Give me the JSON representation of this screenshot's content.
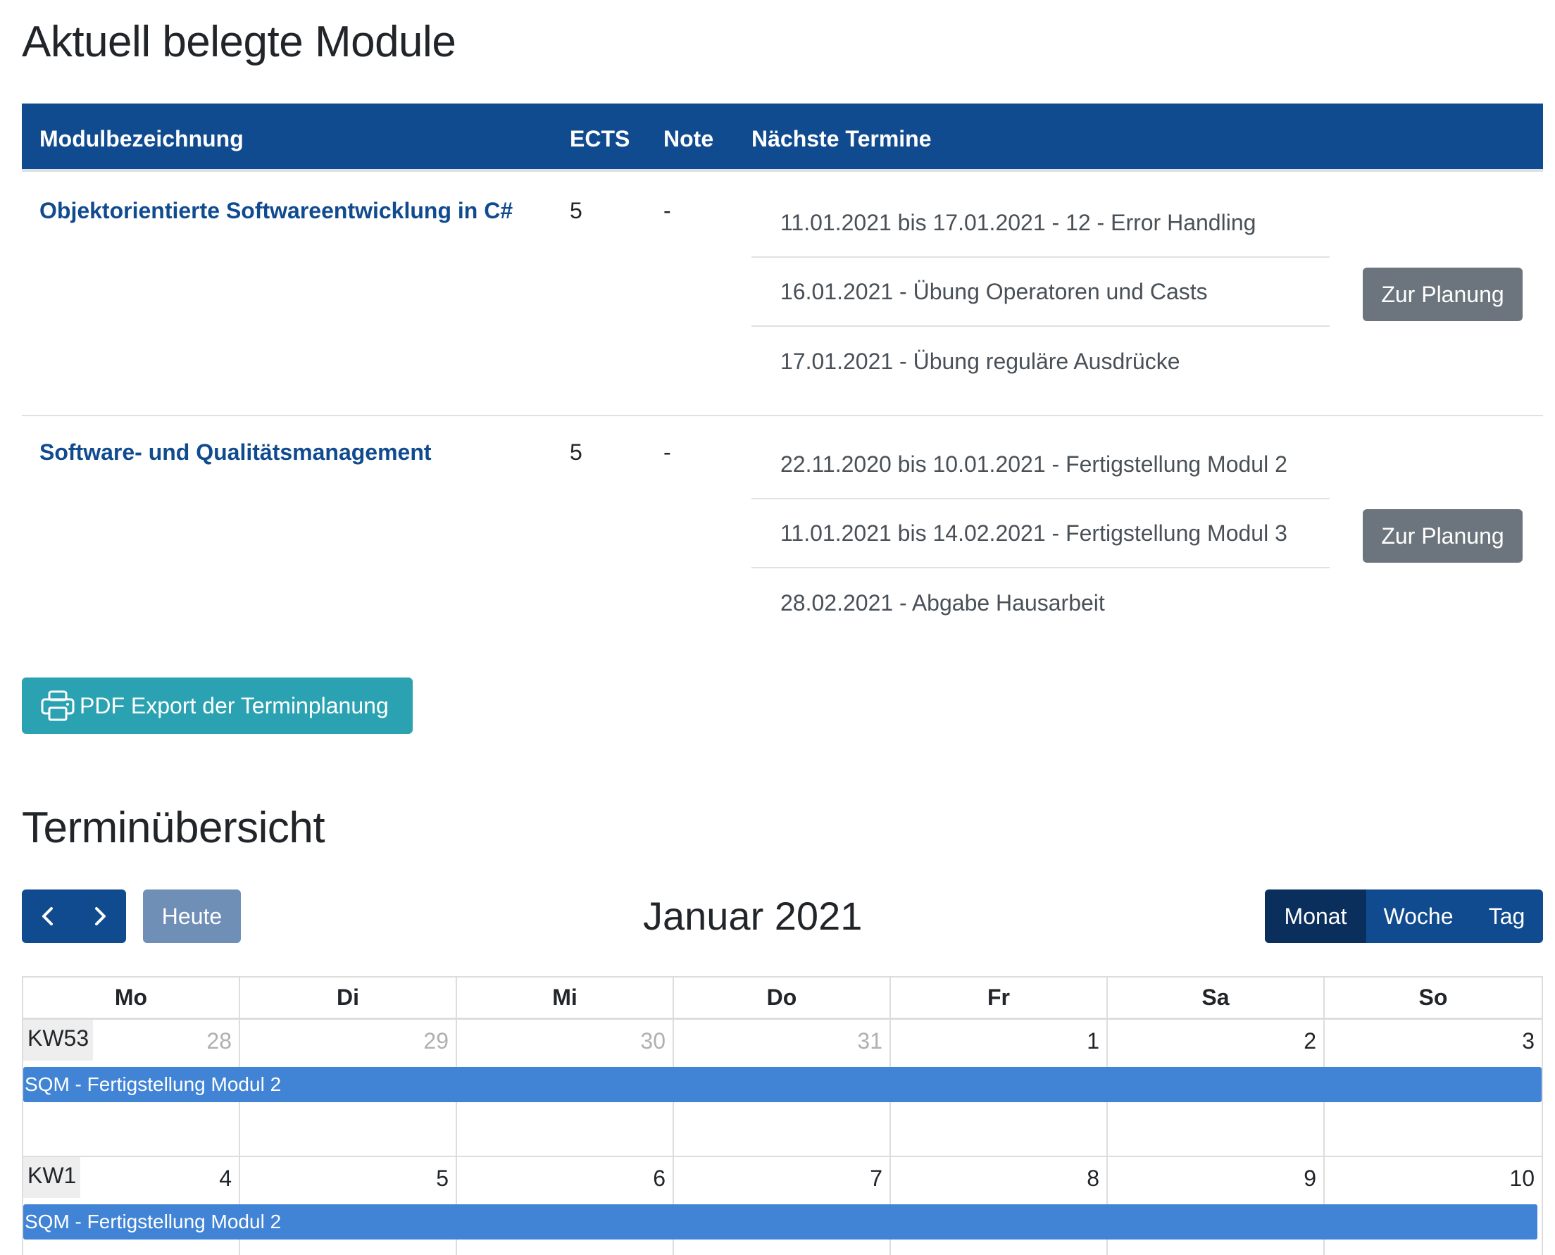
{
  "modules_section": {
    "title": "Aktuell belegte Module",
    "columns": [
      "Modulbezeichnung",
      "ECTS",
      "Note",
      "Nächste Termine"
    ],
    "rows": [
      {
        "name": "Objektorientierte Softwareentwicklung in C#",
        "ects": "5",
        "note": "-",
        "terms": [
          "11.01.2021 bis 17.01.2021 - 12 - Error Handling",
          "16.01.2021 - Übung Operatoren und Casts",
          "17.01.2021 - Übung reguläre Ausdrücke"
        ],
        "button": "Zur Planung"
      },
      {
        "name": "Software- und Qualitätsmanagement",
        "ects": "5",
        "note": "-",
        "terms": [
          "22.11.2020 bis 10.01.2021 - Fertigstellung Modul 2",
          "11.01.2021 bis 14.02.2021 - Fertigstellung Modul 3",
          "28.02.2021 - Abgabe Hausarbeit"
        ],
        "button": "Zur Planung"
      }
    ],
    "pdf_button": "PDF Export der Terminplanung"
  },
  "calendar_section": {
    "title": "Terminübersicht",
    "toolbar": {
      "prev_icon": "chevron-left-icon",
      "next_icon": "chevron-right-icon",
      "today": "Heute",
      "month_title": "Januar 2021",
      "views": [
        "Monat",
        "Woche",
        "Tag"
      ],
      "active_view": "Monat"
    },
    "weekdays": [
      "Mo",
      "Di",
      "Mi",
      "Do",
      "Fr",
      "Sa",
      "So"
    ],
    "weeks": [
      {
        "kw": "KW53",
        "days": [
          "28",
          "29",
          "30",
          "31",
          "1",
          "2",
          "3"
        ],
        "other_month": [
          true,
          true,
          true,
          true,
          false,
          false,
          false
        ],
        "event": "SQM - Fertigstellung Modul 2"
      },
      {
        "kw": "KW1",
        "days": [
          "4",
          "5",
          "6",
          "7",
          "8",
          "9",
          "10"
        ],
        "other_month": [
          false,
          false,
          false,
          false,
          false,
          false,
          false
        ],
        "event": "SQM - Fertigstellung Modul 2"
      }
    ]
  },
  "colors": {
    "primary": "#114b8f",
    "event": "#4184d6",
    "info": "#2aa2b1",
    "secondary": "#6c757d"
  }
}
